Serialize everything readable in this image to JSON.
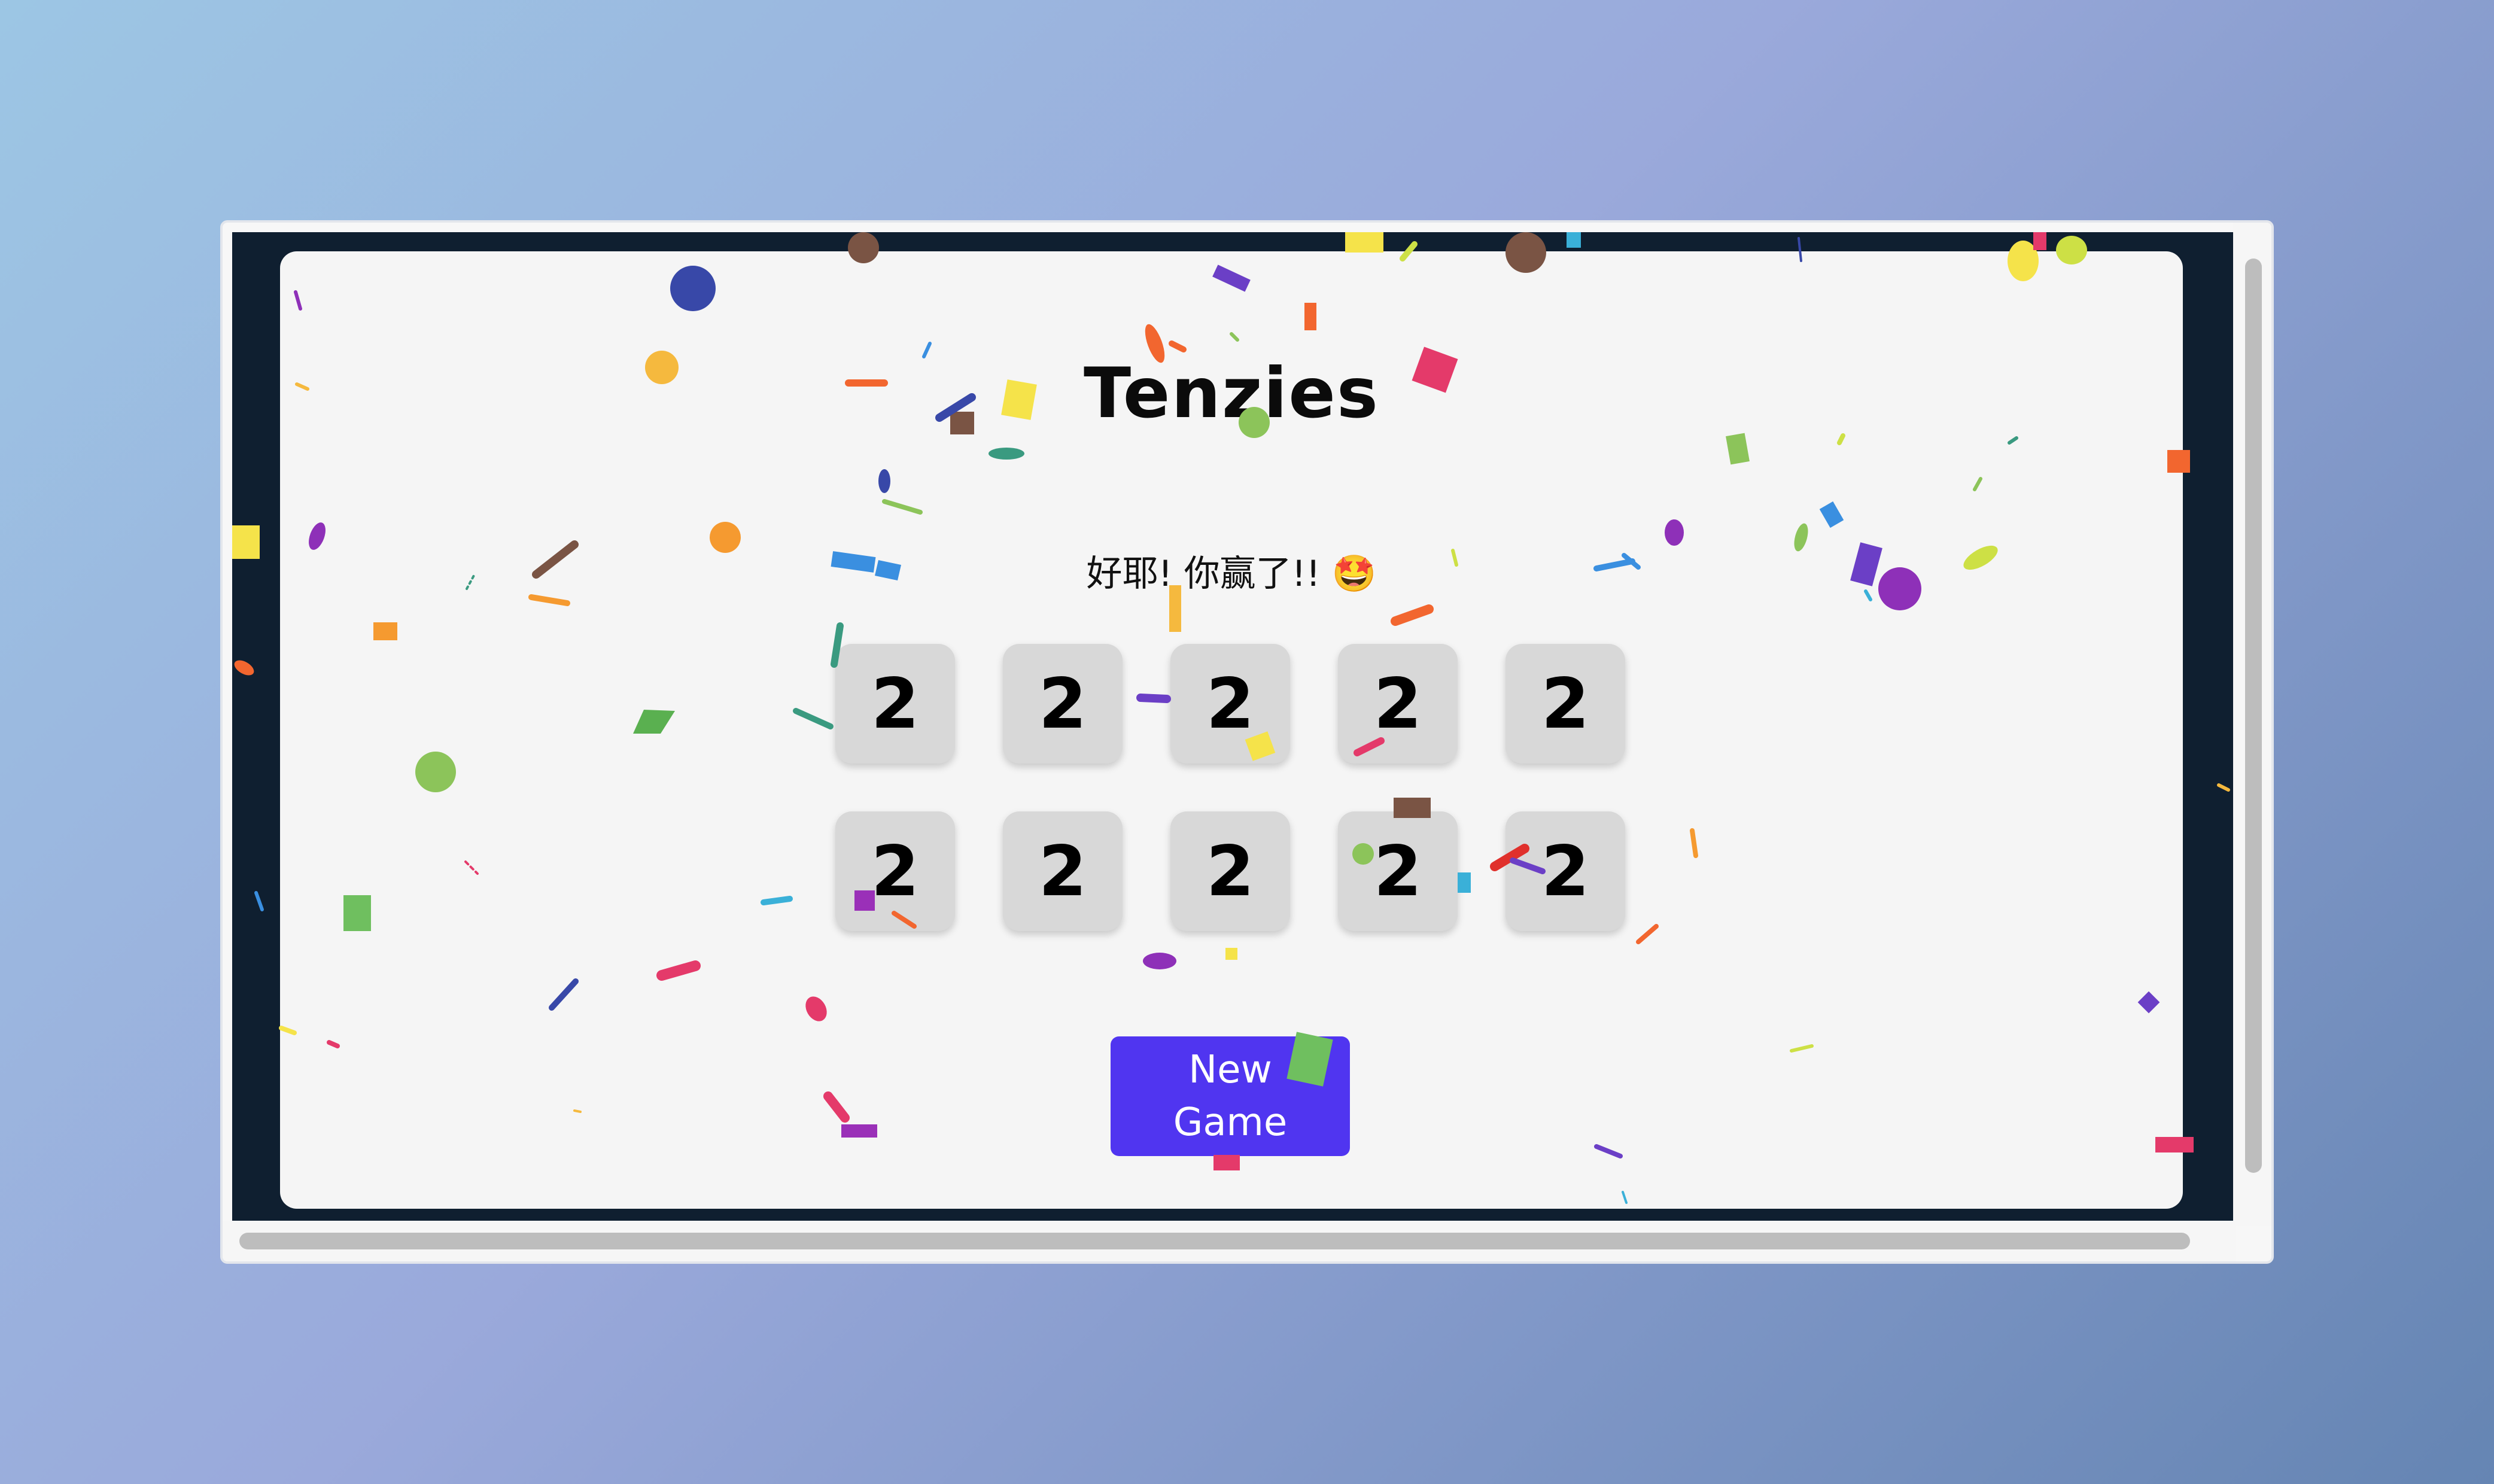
{
  "game": {
    "title": "Tenzies",
    "status_message": "好耶! 你赢了!! 🤩",
    "dice": [
      "2",
      "2",
      "2",
      "2",
      "2",
      "2",
      "2",
      "2",
      "2",
      "2"
    ],
    "new_game_label": "New Game"
  },
  "colors": {
    "page_background": "#0f1f30",
    "card_background": "#f5f5f5",
    "die_background": "#d8d8d8",
    "button_background": "#5035f0",
    "button_text": "#ffffff"
  },
  "decorations": {
    "confetti": "confetti-pieces"
  }
}
